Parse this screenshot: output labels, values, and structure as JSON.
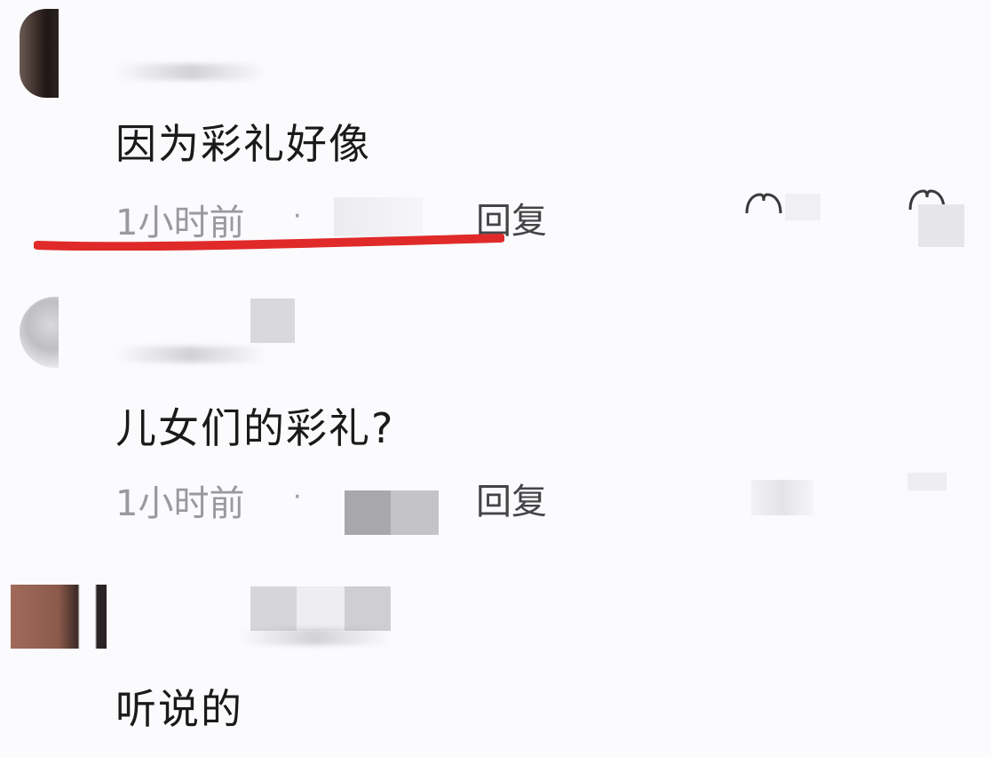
{
  "comments": [
    {
      "text": "因为彩礼好像",
      "time": "1小时前",
      "dot": "·",
      "reply": "回复"
    },
    {
      "text": "儿女们的彩礼?",
      "time": "1小时前",
      "dot": "·",
      "reply": "回复"
    },
    {
      "text": "听说的"
    }
  ],
  "colors": {
    "underline": "#e02a2a"
  },
  "icons": {
    "like": "heart-outline-icon",
    "dislike": "heart-outline-icon"
  }
}
